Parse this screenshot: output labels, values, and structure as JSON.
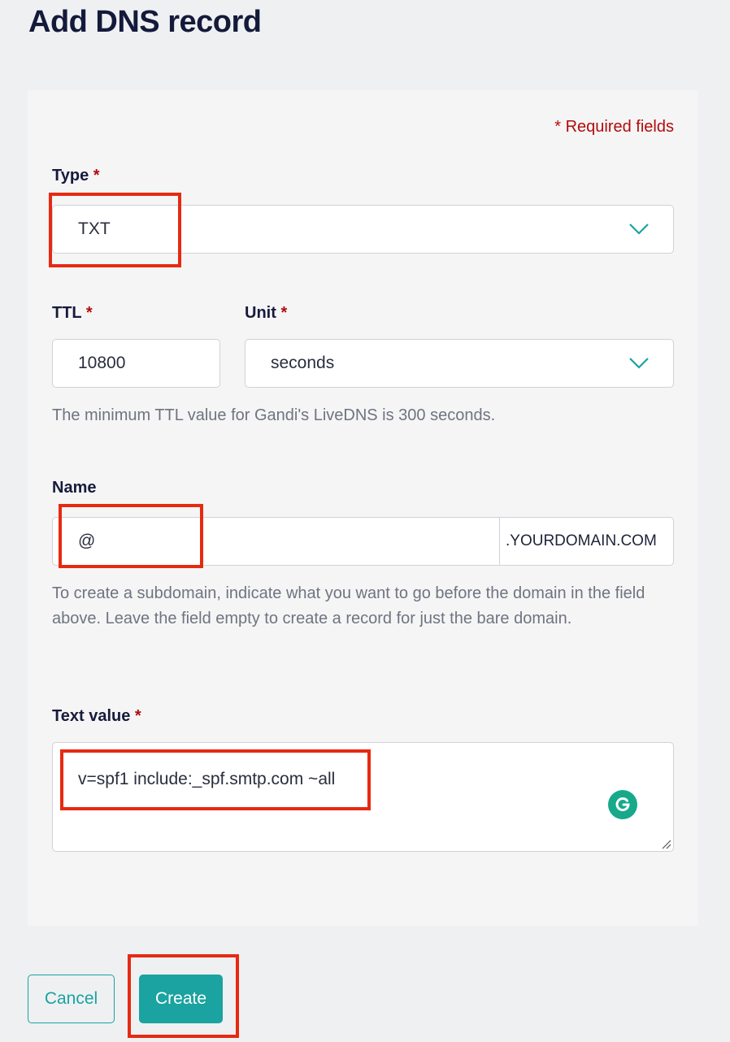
{
  "page": {
    "title": "Add DNS record"
  },
  "form": {
    "required_note": "* Required fields",
    "required_star": "*",
    "type": {
      "label": "Type",
      "value": "TXT"
    },
    "ttl": {
      "label": "TTL",
      "value": "10800"
    },
    "unit": {
      "label": "Unit",
      "value": "seconds"
    },
    "ttl_help": "The minimum TTL value for Gandi's LiveDNS is 300 seconds.",
    "name": {
      "label": "Name",
      "value": "@",
      "suffix": ".YOURDOMAIN.COM",
      "help": "To create a subdomain, indicate what you want to go before the domain in the field above. Leave the field empty to create a record for just the bare domain."
    },
    "text_value": {
      "label": "Text value",
      "value": "v=spf1 include:_spf.smtp.com ~all"
    }
  },
  "actions": {
    "cancel_label": "Cancel",
    "create_label": "Create"
  },
  "icons": {
    "dropdown": "chevron-down-icon",
    "grammarly": "grammarly-icon",
    "resize": "resize-handle-icon"
  },
  "colors": {
    "accent": "#1aa3a0",
    "required": "#b30b0b",
    "highlight": "#e62a12",
    "grammarly": "#17a98a"
  }
}
